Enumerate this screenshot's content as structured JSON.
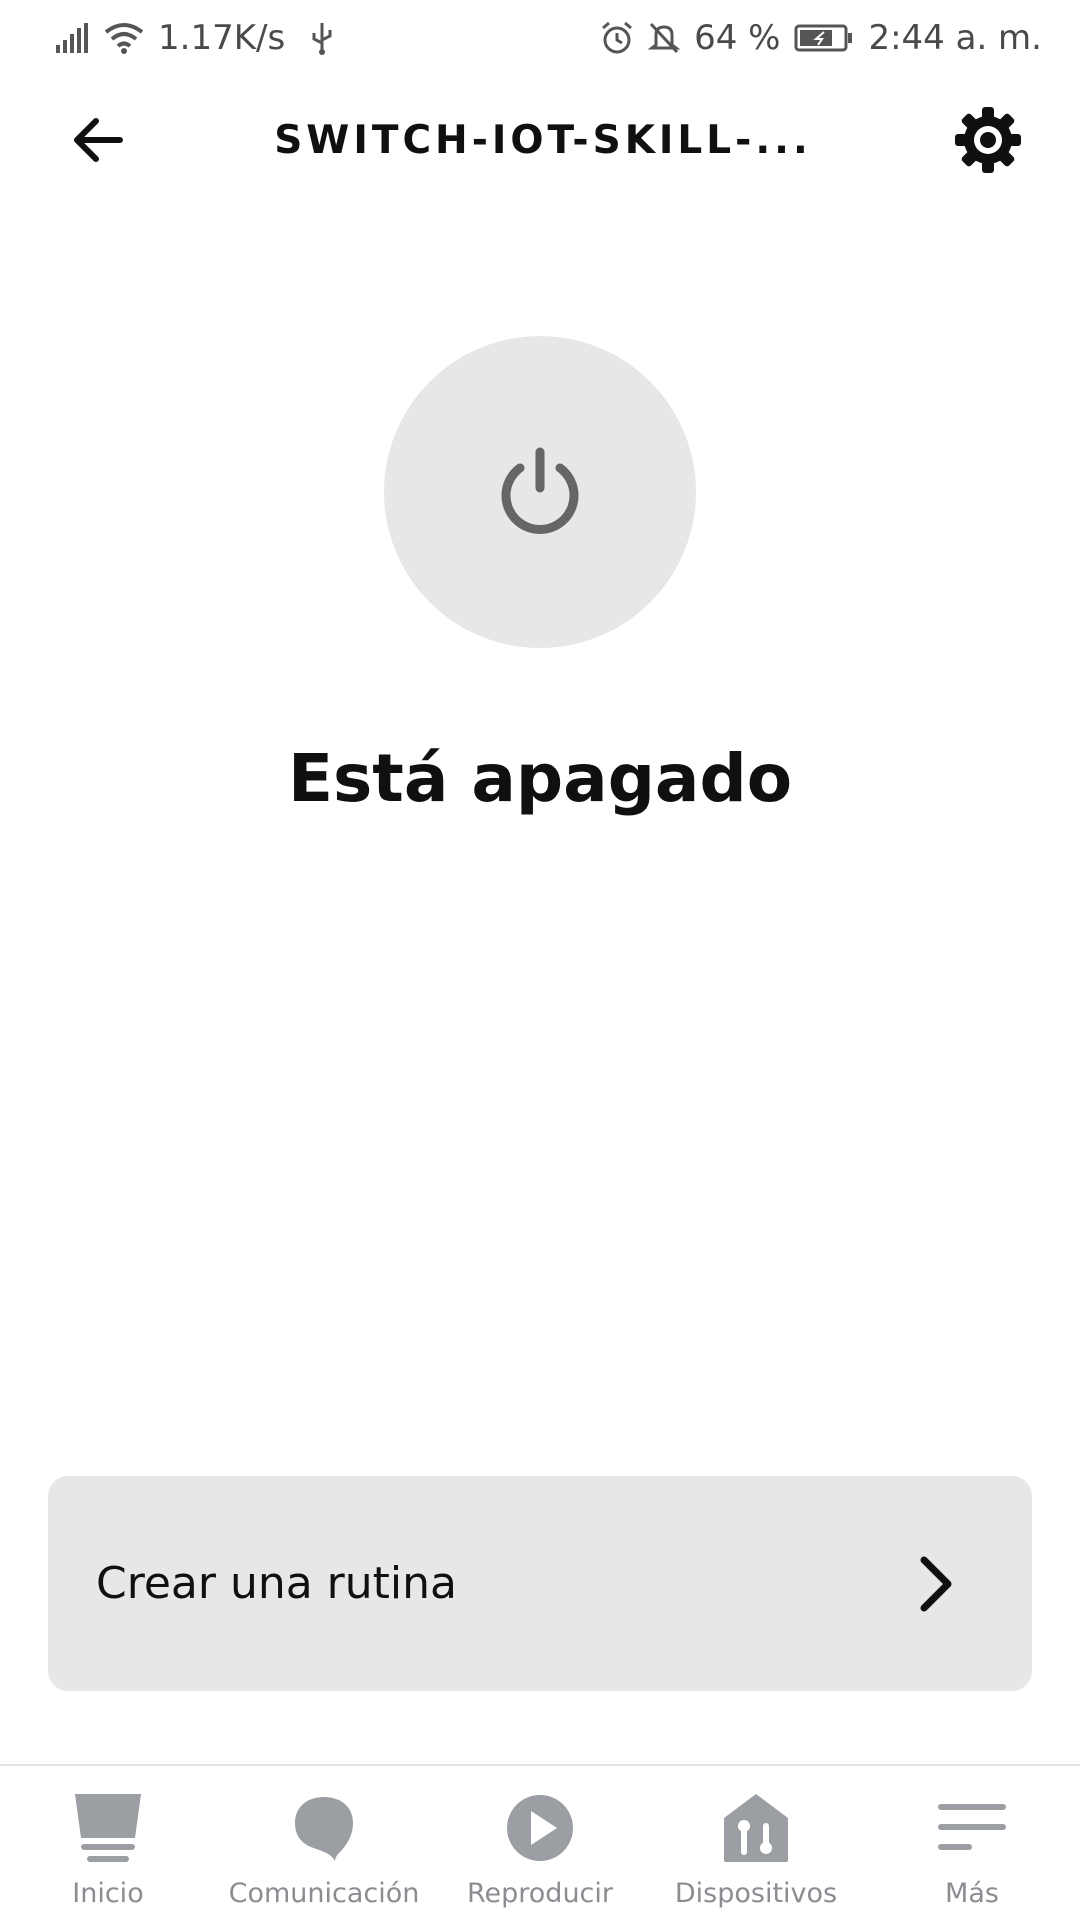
{
  "status_bar": {
    "speed": "1.17K/s",
    "battery": "64 %",
    "time": "2:44 a. m."
  },
  "header": {
    "title": "SWITCH-IOT-SKILL-..."
  },
  "device": {
    "state_text": "Está apagado",
    "power_on": false
  },
  "routine": {
    "label": "Crear una rutina"
  },
  "bottom_nav": {
    "items": [
      {
        "label": "Inicio",
        "icon": "home-icon"
      },
      {
        "label": "Comunicación",
        "icon": "chat-bubble-icon"
      },
      {
        "label": "Reproducir",
        "icon": "play-icon"
      },
      {
        "label": "Dispositivos",
        "icon": "devices-home-icon"
      },
      {
        "label": "Más",
        "icon": "menu-icon"
      }
    ]
  },
  "colors": {
    "text": "#0f1111",
    "muted": "#8a8d91",
    "icon_gray": "#9b9ea2",
    "surface": "#e7e7e7"
  }
}
